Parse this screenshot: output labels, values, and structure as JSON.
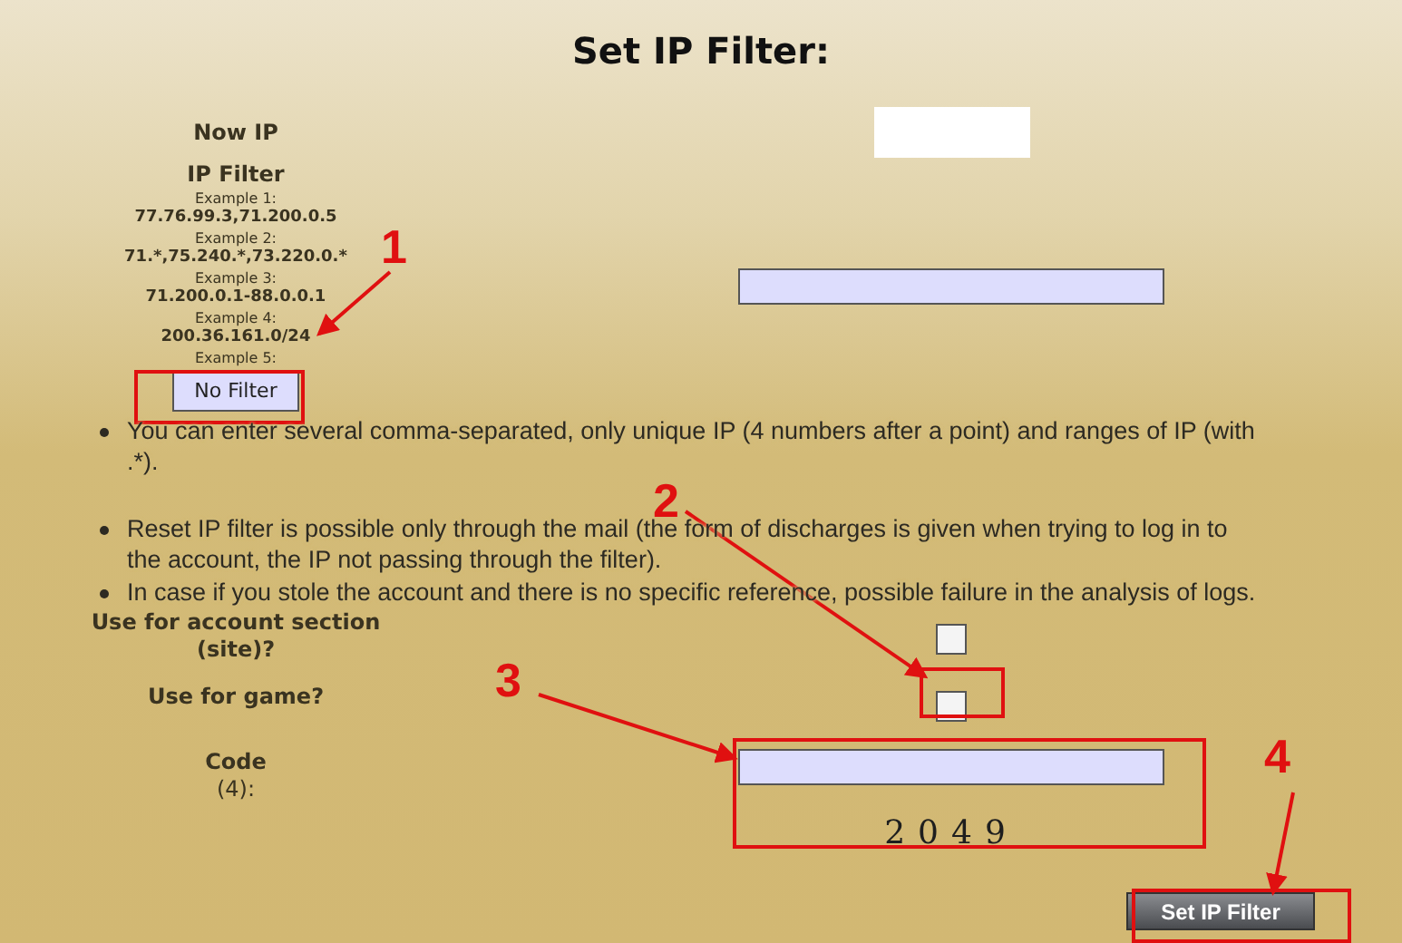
{
  "title": "Set IP Filter:",
  "now_ip": {
    "label": "Now IP"
  },
  "ip_filter": {
    "label": "IP Filter",
    "examples": [
      {
        "caption": "Example 1:",
        "value": "77.76.99.3,71.200.0.5"
      },
      {
        "caption": "Example 2:",
        "value": "71.*,75.240.*,73.220.0.*"
      },
      {
        "caption": "Example 3:",
        "value": "71.200.0.1-88.0.0.1"
      },
      {
        "caption": "Example 4:",
        "value": "200.36.161.0/24"
      },
      {
        "caption": "Example 5:"
      }
    ],
    "no_filter_button": "No Filter"
  },
  "notes": [
    "You can enter several comma-separated, only unique IP (4 numbers after a point) and ranges of IP (with .*).",
    "Reset IP filter is possible only through the mail (the form of discharges is given when trying to log in to the account, the IP not passing through the filter).",
    "In case if you stole the account and there is no specific reference, possible failure in the analysis of logs."
  ],
  "options": [
    {
      "label": "Use for account section (site)?",
      "checked": false
    },
    {
      "label": "Use for game?",
      "checked": false
    }
  ],
  "code": {
    "label": "Code",
    "hint": "(4):",
    "captcha": "2049"
  },
  "submit_button": "Set IP Filter",
  "annotations": [
    {
      "number": "1"
    },
    {
      "number": "2"
    },
    {
      "number": "3"
    },
    {
      "number": "4"
    }
  ]
}
